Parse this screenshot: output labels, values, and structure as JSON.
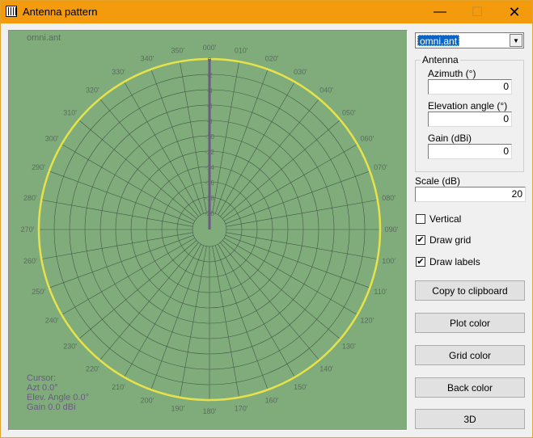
{
  "window": {
    "title": "Antenna pattern",
    "controls": {
      "minimize": "—",
      "maximize": "☐",
      "close": "✕"
    }
  },
  "plot": {
    "file_label": "omni.ant",
    "azimuth_labels": [
      "000",
      "010",
      "020",
      "030",
      "040",
      "050",
      "060",
      "070",
      "080",
      "090",
      "100",
      "110",
      "120",
      "130",
      "140",
      "150",
      "160",
      "170",
      "180",
      "190",
      "200",
      "210",
      "220",
      "230",
      "240",
      "250",
      "260",
      "270",
      "280",
      "290",
      "300",
      "310",
      "320",
      "330",
      "340",
      "350"
    ],
    "ring_labels": [
      "0",
      "-2",
      "-4",
      "-6",
      "-8",
      "-10",
      "-12",
      "-14",
      "-16",
      "-18",
      "-20"
    ],
    "cursor": {
      "title": "Cursor:",
      "azimuth": "Azt 0.0°",
      "elevation": "Elev. Angle 0.0°",
      "gain": "Gain 0.0 dBi"
    },
    "colors": {
      "background": "#7fac7a",
      "grid": "#46584a",
      "pattern": "#e8e24a",
      "pointer": "#6b5a84",
      "labels": "#5b6b60"
    }
  },
  "sidebar": {
    "file_select": {
      "value": "omni.ant"
    },
    "antenna": {
      "title": "Antenna",
      "azimuth_label": "Azimuth (°)",
      "azimuth_value": "0",
      "elevation_label": "Elevation angle (°)",
      "elevation_value": "0",
      "gain_label": "Gain (dBi)",
      "gain_value": "0"
    },
    "scale_label": "Scale (dB)",
    "scale_value": "20",
    "vertical": {
      "label": "Vertical",
      "checked": false
    },
    "draw_grid": {
      "label": "Draw grid",
      "checked": true
    },
    "draw_labels": {
      "label": "Draw labels",
      "checked": true
    },
    "buttons": {
      "copy": "Copy to clipboard",
      "plot_color": "Plot color",
      "grid_color": "Grid color",
      "back_color": "Back color",
      "three_d": "3D"
    }
  }
}
